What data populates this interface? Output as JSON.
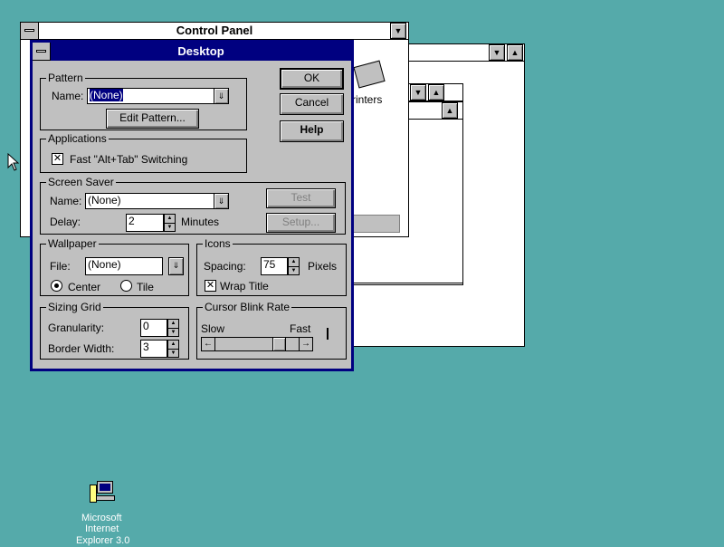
{
  "control_panel": {
    "title": "Control Panel",
    "printers_label": "Printers"
  },
  "desktop_icon": {
    "label_line1": "Microsoft",
    "label_line2": "Internet",
    "label_line3": "Explorer 3.0"
  },
  "dialog": {
    "title": "Desktop",
    "ok_label": "OK",
    "cancel_label": "Cancel",
    "help_label": "Help",
    "pattern": {
      "group_label": "Pattern",
      "name_label": "Name:",
      "name_value": "(None)",
      "edit_label": "Edit Pattern..."
    },
    "applications": {
      "group_label": "Applications",
      "fast_switch_label": "Fast \"Alt+Tab\" Switching",
      "fast_switch_checked": true
    },
    "screen_saver": {
      "group_label": "Screen Saver",
      "name_label": "Name:",
      "name_value": "(None)",
      "delay_label": "Delay:",
      "delay_value": "2",
      "minutes_label": "Minutes",
      "test_label": "Test",
      "setup_label": "Setup..."
    },
    "wallpaper": {
      "group_label": "Wallpaper",
      "file_label": "File:",
      "file_value": "(None)",
      "center_label": "Center",
      "tile_label": "Tile",
      "selected": "center"
    },
    "icons": {
      "group_label": "Icons",
      "spacing_label": "Spacing:",
      "spacing_value": "75",
      "pixels_label": "Pixels",
      "wrap_title_label": "Wrap Title",
      "wrap_title_checked": true
    },
    "sizing_grid": {
      "group_label": "Sizing Grid",
      "granularity_label": "Granularity:",
      "granularity_value": "0",
      "border_width_label": "Border Width:",
      "border_width_value": "3"
    },
    "cursor_blink": {
      "group_label": "Cursor Blink Rate",
      "slow_label": "Slow",
      "fast_label": "Fast",
      "rate_fraction": 0.82
    }
  },
  "icons": {
    "checkmark": "✕",
    "down_arrow": "⇓",
    "up_arrow": "▲",
    "down_triangle": "▼",
    "left_arrow": "←",
    "right_arrow": "→"
  }
}
